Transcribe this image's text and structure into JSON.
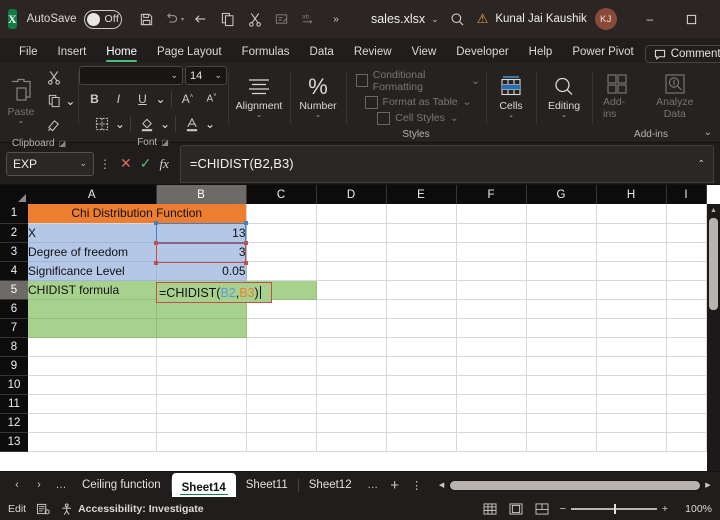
{
  "titlebar": {
    "app_icon": "excel-logo",
    "autosave_label": "AutoSave",
    "autosave_state": "Off",
    "quick_access": [
      {
        "name": "save-icon",
        "glyph": "save"
      },
      {
        "name": "undo-icon",
        "glyph": "undo"
      },
      {
        "name": "redo-icon",
        "glyph": "redo"
      },
      {
        "name": "copy-icon",
        "glyph": "copy"
      },
      {
        "name": "cut-icon",
        "glyph": "cut"
      },
      {
        "name": "sort-filter-icon",
        "glyph": "sort"
      },
      {
        "name": "spelling-icon",
        "glyph": "spelling"
      },
      {
        "name": "more-commands-icon",
        "glyph": "more"
      }
    ],
    "filename": "sales.xlsx",
    "search_icon": "search-icon",
    "warning_icon": "warning-icon",
    "user_name": "Kunal Jai Kaushik",
    "user_initials": "KJ",
    "minimize": "–",
    "maximize": "□",
    "close": "✕"
  },
  "ribbon": {
    "tabs": [
      {
        "label": "File",
        "active": false
      },
      {
        "label": "Insert",
        "active": false
      },
      {
        "label": "Home",
        "active": true
      },
      {
        "label": "Page Layout",
        "active": false
      },
      {
        "label": "Formulas",
        "active": false
      },
      {
        "label": "Data",
        "active": false
      },
      {
        "label": "Review",
        "active": false
      },
      {
        "label": "View",
        "active": false
      },
      {
        "label": "Developer",
        "active": false
      },
      {
        "label": "Help",
        "active": false
      },
      {
        "label": "Power Pivot",
        "active": false
      }
    ],
    "comments_label": "Comments",
    "share_label": "",
    "groups": [
      {
        "name": "clipboard",
        "label": "Clipboard",
        "paste_label": "Paste"
      },
      {
        "name": "font",
        "label": "Font",
        "font_name": "",
        "font_size": "14",
        "bold": "B",
        "italic": "I",
        "underline": "U",
        "grow_font": "A",
        "shrink_font": "A"
      },
      {
        "name": "alignment",
        "label": "",
        "caption": "Alignment"
      },
      {
        "name": "number",
        "label": "",
        "caption": "Number"
      },
      {
        "name": "styles",
        "label": "Styles",
        "items": [
          "Conditional Formatting",
          "Format as Table",
          "Cell Styles"
        ]
      },
      {
        "name": "cells",
        "label": "",
        "caption": "Cells"
      },
      {
        "name": "editing",
        "label": "",
        "caption": "Editing"
      },
      {
        "name": "addins",
        "label": "Add-ins",
        "items": [
          "Add-ins",
          "Analyze Data"
        ]
      }
    ]
  },
  "formula_bar": {
    "name_box_value": "EXP",
    "cancel_icon": "cancel-icon",
    "enter_icon": "confirm-icon",
    "function_icon": "insert-function-icon",
    "formula_text": "=CHIDIST(B2,B3)",
    "expand_icon": "chevron-up-icon"
  },
  "grid": {
    "columns": [
      "A",
      "B",
      "C",
      "D",
      "E",
      "F",
      "G",
      "H",
      "I"
    ],
    "active_column": "B",
    "active_row": 5,
    "rows": [
      1,
      2,
      3,
      4,
      5,
      6,
      7,
      8,
      9,
      10,
      11,
      12,
      13
    ],
    "cells": {
      "A1": {
        "text": "Chi Distribution Function",
        "fill": "orange",
        "align": "center",
        "merged": true
      },
      "A2": {
        "text": "X",
        "fill": "blue",
        "align": "left"
      },
      "B2": {
        "text": "13",
        "fill": "blue",
        "align": "right"
      },
      "A3": {
        "text": "Degree of freedom",
        "fill": "blue",
        "align": "left"
      },
      "B3": {
        "text": "3",
        "fill": "blue",
        "align": "right"
      },
      "A4": {
        "text": "Significance Level",
        "fill": "blue",
        "align": "left"
      },
      "B4": {
        "text": "0.05",
        "fill": "blue",
        "align": "right"
      },
      "A5": {
        "text": "CHIDIST formula",
        "fill": "green",
        "align": "left"
      },
      "B5": {
        "text": "=CHIDIST(B2,B3)",
        "fill": "green",
        "align": "left",
        "editing": true
      },
      "C5": {
        "text": "",
        "fill": "green"
      },
      "A6": {
        "text": "",
        "fill": "green"
      },
      "B6": {
        "text": "",
        "fill": "green"
      },
      "A7": {
        "text": "",
        "fill": "green"
      },
      "B7": {
        "text": "",
        "fill": "green"
      }
    },
    "editing_cell": {
      "address": "B5",
      "prefix": "=CHIDIST(",
      "ref1": "B2",
      "comma": ",",
      "ref2": "B3",
      "suffix": ")"
    },
    "reference_colors": {
      "ref1": "#5b9bd5",
      "ref2": "#ed7d31"
    },
    "fill_colors": {
      "orange": "#ED7D31",
      "blue": "#B4C7E7",
      "green": "#A9D18E"
    }
  },
  "sheet_tabs": {
    "first_icon": "first-sheet-icon",
    "prev_icon": "previous-sheet-icon",
    "next_icon": "next-sheet-icon",
    "overflow_left": "…",
    "overflow_right": "…",
    "tabs": [
      {
        "label": "Ceiling function",
        "active": false
      },
      {
        "label": "Sheet14",
        "active": true
      },
      {
        "label": "Sheet11",
        "active": false
      },
      {
        "label": "Sheet12",
        "active": false
      }
    ],
    "add_sheet_label": "+",
    "more_label": "⋮"
  },
  "status_bar": {
    "mode": "Edit",
    "macro_icon": "record-macro-icon",
    "accessibility_icon": "accessibility-icon",
    "accessibility_text": "Accessibility: Investigate",
    "view_normal": "normal-view-icon",
    "view_layout": "page-layout-view-icon",
    "view_break": "page-break-view-icon",
    "zoom_out": "−",
    "zoom_in": "+",
    "zoom_level": "100%"
  }
}
